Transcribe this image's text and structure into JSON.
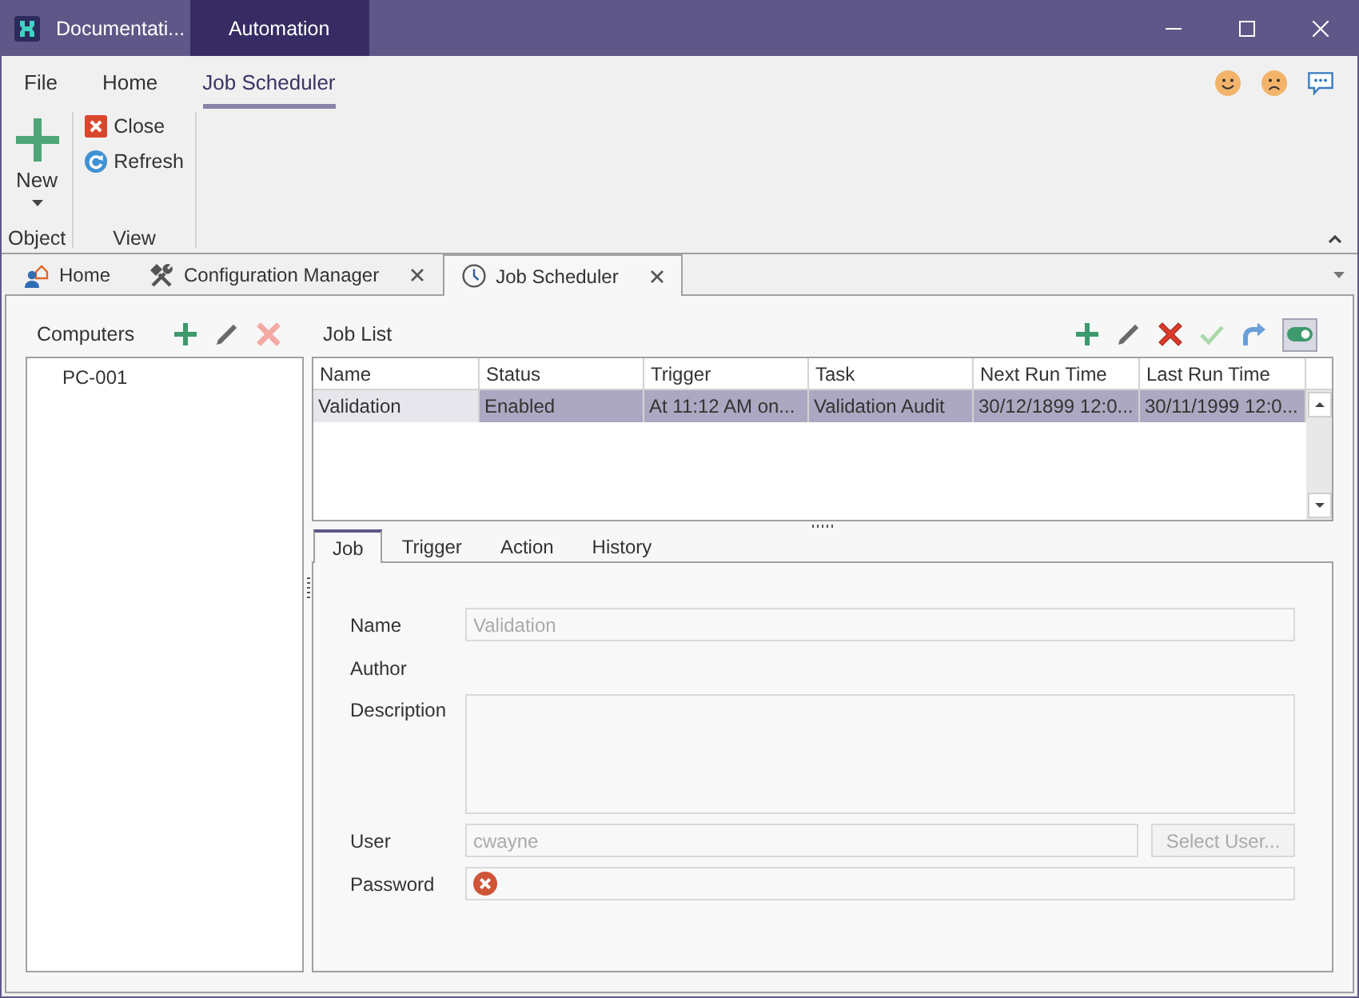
{
  "window": {
    "tabs": [
      {
        "label": "Documentati...",
        "selected": false
      },
      {
        "label": "Automation",
        "selected": true
      }
    ]
  },
  "ribbon": {
    "tabs": [
      {
        "label": "File",
        "selected": false
      },
      {
        "label": "Home",
        "selected": false
      },
      {
        "label": "Job Scheduler",
        "selected": true
      }
    ],
    "groups": [
      {
        "label": "Object",
        "buttons": [
          {
            "label": "New",
            "kind": "large",
            "dropdown": true
          }
        ]
      },
      {
        "label": "View",
        "buttons": [
          {
            "label": "Close",
            "kind": "small",
            "dropdown": false
          },
          {
            "label": "Refresh",
            "kind": "small",
            "dropdown": false
          }
        ]
      }
    ]
  },
  "document_tabs": [
    {
      "label": "Home",
      "selected": false,
      "closable": false
    },
    {
      "label": "Configuration Manager",
      "selected": false,
      "closable": true
    },
    {
      "label": "Job Scheduler",
      "selected": true,
      "closable": true
    }
  ],
  "computers": {
    "title": "Computers",
    "toolbar": [
      {
        "kind": "add",
        "disabled": false
      },
      {
        "kind": "edit",
        "disabled": false
      },
      {
        "kind": "delete",
        "disabled": true
      }
    ],
    "items": [
      {
        "label": "PC-001",
        "selected": false
      }
    ]
  },
  "job_list": {
    "title": "Job List",
    "toolbar": [
      {
        "kind": "add",
        "disabled": false
      },
      {
        "kind": "edit",
        "disabled": false
      },
      {
        "kind": "delete",
        "disabled": false
      },
      {
        "kind": "apply",
        "disabled": true
      },
      {
        "kind": "redo",
        "disabled": false
      },
      {
        "kind": "toggle",
        "disabled": false,
        "pressed": true
      }
    ],
    "columns": [
      "Name",
      "Status",
      "Trigger",
      "Task",
      "Next Run Time",
      "Last Run Time"
    ],
    "rows": [
      {
        "selected": true,
        "cells": [
          {
            "text": "Validation",
            "focused": true
          },
          {
            "text": "Enabled",
            "focused": false
          },
          {
            "text": "At 11:12 AM on...",
            "focused": false
          },
          {
            "text": "Validation Audit",
            "focused": false
          },
          {
            "text": "30/12/1899 12:0...",
            "focused": false
          },
          {
            "text": "30/11/1999 12:0...",
            "focused": false
          }
        ]
      }
    ]
  },
  "detail_tabs": [
    {
      "label": "Job",
      "selected": true
    },
    {
      "label": "Trigger",
      "selected": false
    },
    {
      "label": "Action",
      "selected": false
    },
    {
      "label": "History",
      "selected": false
    }
  ],
  "job_form": {
    "fields": [
      {
        "label": "Name",
        "kind": "text",
        "value": "Validation",
        "disabled": true,
        "invalid": false
      },
      {
        "label": "Author",
        "kind": "static"
      },
      {
        "label": "Description",
        "kind": "textarea",
        "invalid": false
      },
      {
        "label": "User",
        "kind": "text",
        "value": "cwayne",
        "disabled": true,
        "invalid": false,
        "button": {
          "label": "Select User...",
          "disabled": true
        }
      },
      {
        "label": "Password",
        "kind": "password",
        "invalid": true
      }
    ]
  }
}
